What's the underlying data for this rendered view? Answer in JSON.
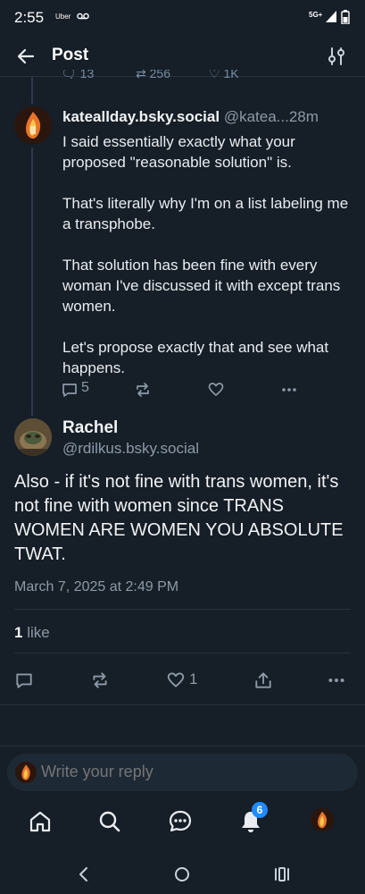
{
  "status_bar": {
    "time": "2:55",
    "carrier_app": "Uber",
    "network": "5G+",
    "voicemail_icon": "voicemail-icon",
    "signal_icon": "signal-icon",
    "battery_icon": "battery-icon"
  },
  "header": {
    "title": "Post",
    "back_icon": "arrow-left-icon",
    "filter_icon": "sliders-icon"
  },
  "parent_post_actions_partial": {
    "replies": "13",
    "reposts": "256",
    "likes": "1K"
  },
  "reply": {
    "display_name": "kateallday.bsky.social",
    "handle": "@katea...",
    "time_ago": "28m",
    "paragraphs": [
      "I said essentially exactly what your proposed \"reasonable solution\" is.",
      "That's literally why I'm on a list labeling me a transphobe.",
      "That solution has been fine with every woman I've discussed it with except trans women.",
      "Let's propose exactly that and see what happens."
    ],
    "reply_count": "5",
    "repost_count": "",
    "like_count": ""
  },
  "main_post": {
    "display_name": "Rachel",
    "handle": "@rdilkus.bsky.social",
    "text": "Also - if it's not fine with trans women, it's not fine with women since TRANS WOMEN ARE WOMEN YOU ABSOLUTE TWAT.",
    "timestamp": "March 7, 2025 at 2:49 PM",
    "likes_count": "1",
    "likes_label": "like",
    "action_like_count": "1"
  },
  "composer": {
    "placeholder": "Write your reply"
  },
  "bottom_nav": {
    "notifications_badge": "6",
    "items": [
      "home-icon",
      "search-icon",
      "chat-icon",
      "bell-icon",
      "profile-avatar"
    ]
  },
  "colors": {
    "background": "#161e27",
    "text_primary": "#f1f3f5",
    "text_secondary": "#8d9aa8",
    "accent": "#208bfe",
    "divider": "#263241"
  }
}
